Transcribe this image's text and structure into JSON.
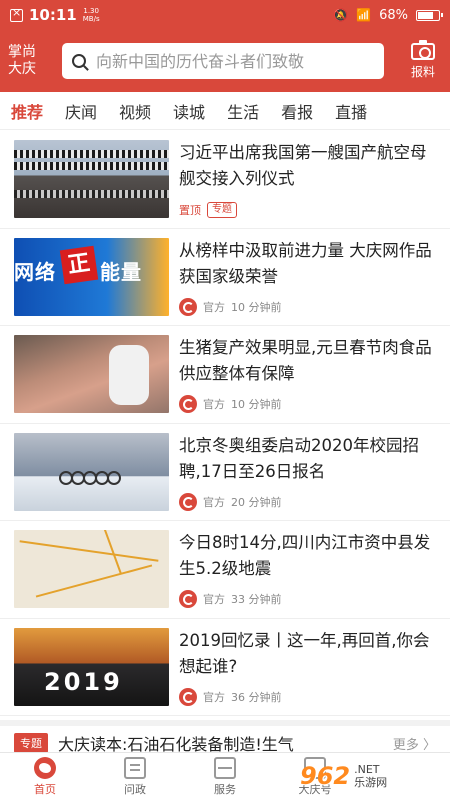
{
  "status_bar": {
    "time": "10:11",
    "speed_value": "1.30",
    "speed_unit": "MB/s",
    "battery": "68%"
  },
  "header": {
    "brand_line1": "掌尚",
    "brand_line2": "大庆",
    "search_placeholder": "向新中国的历代奋斗者们致敬",
    "report_label": "报料"
  },
  "tabs": [
    "推荐",
    "庆闻",
    "视频",
    "读城",
    "生活",
    "看报",
    "直播"
  ],
  "news": [
    {
      "title": "习近平出席我国第一艘国产航空母舰交接入列仪式",
      "tag_top": "置顶",
      "tag_topic": "专题"
    },
    {
      "title": "从榜样中汲取前进力量 大庆网作品获国家级荣誉",
      "source": "官方",
      "time": "10 分钟前",
      "thumb_text_1": "网络",
      "thumb_text_2": "正",
      "thumb_text_3": "能量"
    },
    {
      "title": "生猪复产效果明显,元旦春节肉食品供应整体有保障",
      "source": "官方",
      "time": "10 分钟前"
    },
    {
      "title": "北京冬奥组委启动2020年校园招聘,17日至26日报名",
      "source": "官方",
      "time": "20 分钟前"
    },
    {
      "title": "今日8时14分,四川内江市资中县发生5.2级地震",
      "source": "官方",
      "time": "33 分钟前"
    },
    {
      "title": "2019回忆录丨这一年,再回首,你会想起谁?",
      "source": "官方",
      "time": "36 分钟前",
      "thumb_text": "2019"
    }
  ],
  "topic_strip": {
    "label": "专题",
    "text": "大庆读本:石油石化装备制造!生气",
    "more": "更多 〉"
  },
  "bottom_nav": {
    "home": "首页",
    "policy": "问政",
    "service": "服务",
    "daqing": "大庆号"
  },
  "watermark": {
    "logo": "962",
    "site_cn": "乐游网",
    "site_en": ".NET"
  },
  "colors": {
    "accent": "#d9483b"
  }
}
